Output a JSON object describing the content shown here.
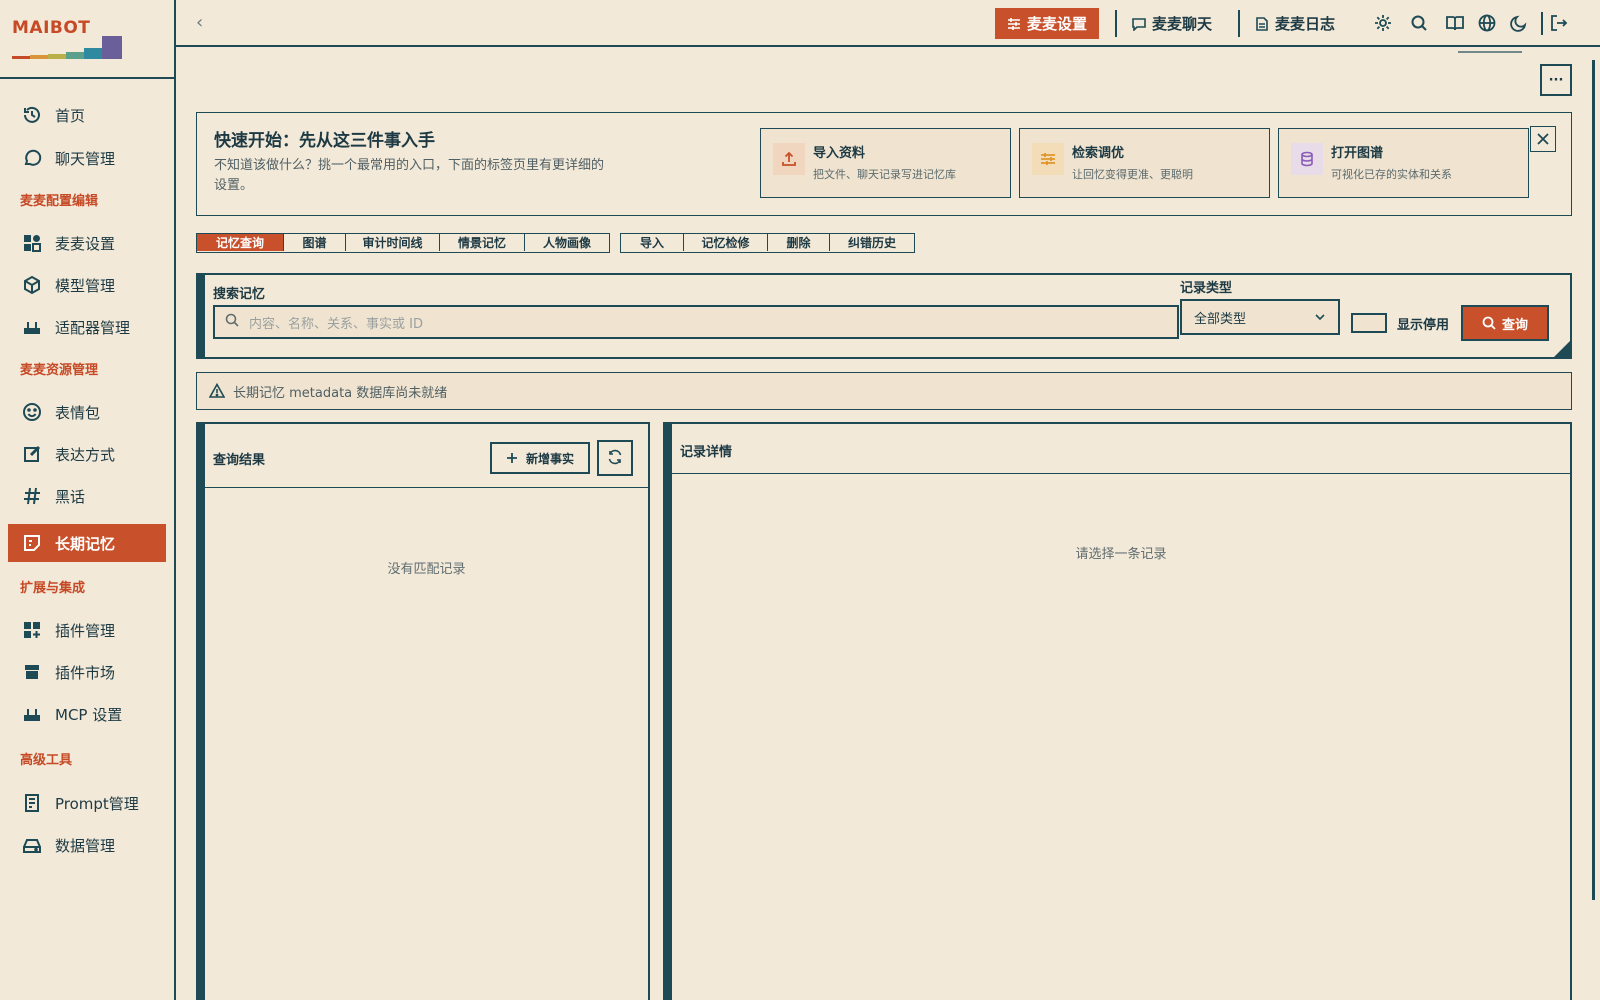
{
  "brand": {
    "title": "MAIBOT"
  },
  "sidebar": {
    "items": [
      {
        "label": "首页",
        "icon": "history-icon",
        "active": false
      },
      {
        "label": "聊天管理",
        "icon": "chat-bubble-icon",
        "active": false
      },
      {
        "label": "麦麦设置",
        "icon": "settings-shapes-icon",
        "active": false
      },
      {
        "label": "模型管理",
        "icon": "cube-icon",
        "active": false
      },
      {
        "label": "适配器管理",
        "icon": "router-icon",
        "active": false
      },
      {
        "label": "表情包",
        "icon": "smile-icon",
        "active": false
      },
      {
        "label": "表达方式",
        "icon": "edit-square-icon",
        "active": false
      },
      {
        "label": "黑话",
        "icon": "hash-icon",
        "active": false
      },
      {
        "label": "长期记忆",
        "icon": "note-icon",
        "active": true
      },
      {
        "label": "插件管理",
        "icon": "grid-plus-icon",
        "active": false
      },
      {
        "label": "插件市场",
        "icon": "store-icon",
        "active": false
      },
      {
        "label": "MCP 设置",
        "icon": "router-icon",
        "active": false
      },
      {
        "label": "Prompt管理",
        "icon": "document-icon",
        "active": false
      },
      {
        "label": "数据管理",
        "icon": "drive-icon",
        "active": false
      }
    ],
    "sections": [
      "麦麦配置编辑",
      "麦麦资源管理",
      "扩展与集成",
      "高级工具"
    ]
  },
  "topbar": {
    "settings_label": "麦麦设置",
    "chat_label": "麦麦聊天",
    "log_label": "麦麦日志"
  },
  "quickstart": {
    "title": "快速开始：先从这三件事入手",
    "desc": "不知道该做什么？挑一个最常用的入口，下面的标签页里有更详细的设置。",
    "cards": [
      {
        "title": "导入资料",
        "desc": "把文件、聊天记录写进记忆库"
      },
      {
        "title": "检索调优",
        "desc": "让回忆变得更准、更聪明"
      },
      {
        "title": "打开图谱",
        "desc": "可视化已存的实体和关系"
      }
    ]
  },
  "tabs": {
    "group1": [
      "记忆查询",
      "图谱",
      "审计时间线",
      "情景记忆",
      "人物画像"
    ],
    "group2": [
      "导入",
      "记忆检修",
      "删除",
      "纠错历史"
    ]
  },
  "search": {
    "label": "搜索记忆",
    "placeholder": "内容、名称、关系、事实或 ID",
    "type_label": "记录类型",
    "type_value": "全部类型",
    "show_disabled": "显示停用",
    "query_button": "查询"
  },
  "warning": {
    "text": "长期记忆 metadata 数据库尚未就绪"
  },
  "results": {
    "title": "查询结果",
    "add_button": "新增事实",
    "empty": "没有匹配记录"
  },
  "details": {
    "title": "记录详情",
    "empty": "请选择一条记录"
  },
  "colors": {
    "accent": "#c8502a",
    "ink": "#1d4a55",
    "background": "#f3e9d8"
  }
}
